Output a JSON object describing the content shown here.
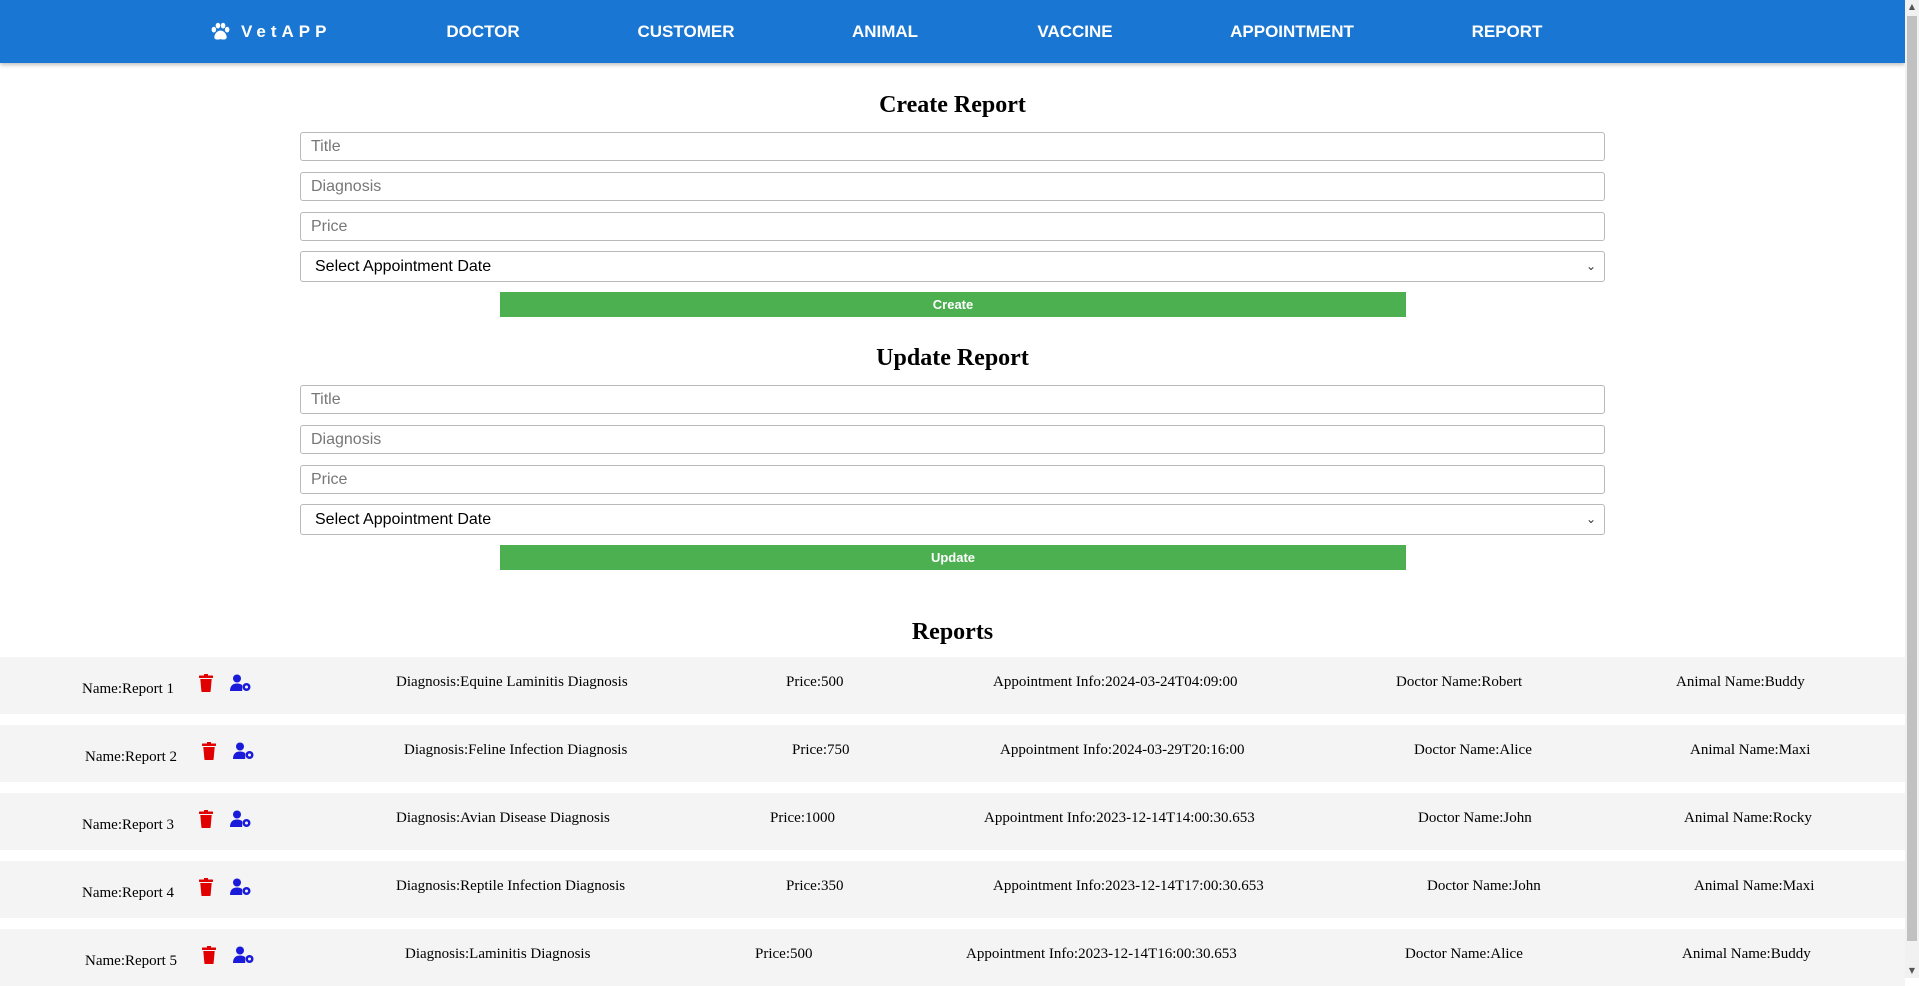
{
  "nav": {
    "brand": "VetAPP",
    "items": [
      {
        "label": "DOCTOR"
      },
      {
        "label": "CUSTOMER"
      },
      {
        "label": "ANIMAL"
      },
      {
        "label": "VACCINE"
      },
      {
        "label": "APPOINTMENT"
      },
      {
        "label": "REPORT"
      }
    ]
  },
  "create_form": {
    "title": "Create Report",
    "title_placeholder": "Title",
    "diagnosis_placeholder": "Diagnosis",
    "price_placeholder": "Price",
    "appointment_select": "Select Appointment Date",
    "button": "Create"
  },
  "update_form": {
    "title": "Update Report",
    "title_placeholder": "Title",
    "diagnosis_placeholder": "Diagnosis",
    "price_placeholder": "Price",
    "appointment_select": "Select Appointment Date",
    "button": "Update"
  },
  "reports": {
    "title": "Reports",
    "items": [
      {
        "name": "Name:Report 1",
        "diagnosis": "Diagnosis:Equine Laminitis Diagnosis",
        "price": "Price:500",
        "appointment": "Appointment Info:2024-03-24T04:09:00",
        "doctor": "Doctor Name:Robert",
        "animal": "Animal Name:Buddy"
      },
      {
        "name": "Name:Report 2",
        "diagnosis": "Diagnosis:Feline Infection Diagnosis",
        "price": "Price:750",
        "appointment": "Appointment Info:2024-03-29T20:16:00",
        "doctor": "Doctor Name:Alice",
        "animal": "Animal Name:Maxi"
      },
      {
        "name": "Name:Report 3",
        "diagnosis": "Diagnosis:Avian Disease Diagnosis",
        "price": "Price:1000",
        "appointment": "Appointment Info:2023-12-14T14:00:30.653",
        "doctor": "Doctor Name:John",
        "animal": "Animal Name:Rocky"
      },
      {
        "name": "Name:Report 4",
        "diagnosis": "Diagnosis:Reptile Infection Diagnosis",
        "price": "Price:350",
        "appointment": "Appointment Info:2023-12-14T17:00:30.653",
        "doctor": "Doctor Name:John",
        "animal": "Animal Name:Maxi"
      },
      {
        "name": "Name:Report 5",
        "diagnosis": "Diagnosis:Laminitis Diagnosis",
        "price": "Price:500",
        "appointment": "Appointment Info:2023-12-14T16:00:30.653",
        "doctor": "Doctor Name:Alice",
        "animal": "Animal Name:Buddy"
      }
    ]
  },
  "colors": {
    "navbar": "#1976d2",
    "button": "#4caf50",
    "delete_icon": "#e00000",
    "edit_icon": "#1a1adb",
    "row_background": "#f4f4f4"
  },
  "icons": {
    "brand": "paw-icon",
    "delete": "trash-icon",
    "edit": "user-gear-icon",
    "select": "chevron-down-icon"
  }
}
